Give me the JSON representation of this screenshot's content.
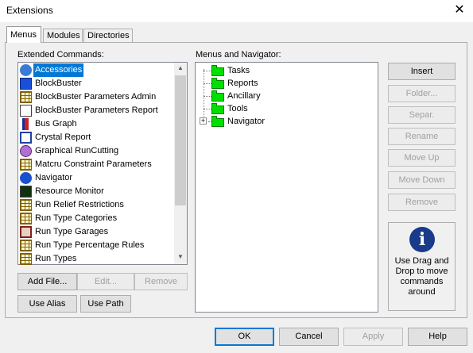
{
  "window": {
    "title": "Extensions",
    "close_glyph": "✕"
  },
  "tabs": [
    {
      "label": "Menus",
      "active": true
    },
    {
      "label": "Modules",
      "active": false
    },
    {
      "label": "Directories",
      "active": false
    }
  ],
  "extended": {
    "label": "Extended Commands:",
    "items": [
      {
        "label": "Accessories",
        "icon": "palette-icon",
        "selected": true
      },
      {
        "label": "BlockBuster",
        "icon": "book-icon"
      },
      {
        "label": "BlockBuster Parameters Admin",
        "icon": "table-icon"
      },
      {
        "label": "BlockBuster Parameters Report",
        "icon": "report-icon"
      },
      {
        "label": "Bus Graph",
        "icon": "bus-graph-icon"
      },
      {
        "label": "Crystal Report",
        "icon": "crystal-report-icon"
      },
      {
        "label": "Graphical RunCutting",
        "icon": "runcutting-icon"
      },
      {
        "label": "Matcru Constraint Parameters",
        "icon": "table-icon"
      },
      {
        "label": "Navigator",
        "icon": "navigator-icon"
      },
      {
        "label": "Resource Monitor",
        "icon": "monitor-icon"
      },
      {
        "label": "Run Relief Restrictions",
        "icon": "table-icon"
      },
      {
        "label": "Run Type Categories",
        "icon": "table-icon"
      },
      {
        "label": "Run Type Garages",
        "icon": "garage-icon"
      },
      {
        "label": "Run Type Percentage Rules",
        "icon": "table-icon"
      },
      {
        "label": "Run Types",
        "icon": "table-icon"
      }
    ],
    "buttons": {
      "add_file": "Add File...",
      "edit": "Edit...",
      "remove": "Remove",
      "use_alias": "Use Alias",
      "use_path": "Use Path"
    }
  },
  "menus": {
    "label": "Menus and Navigator:",
    "items": [
      {
        "label": "Tasks"
      },
      {
        "label": "Reports"
      },
      {
        "label": "Ancillary"
      },
      {
        "label": "Tools"
      },
      {
        "label": "Navigator",
        "expandable": true,
        "expander": "+"
      }
    ]
  },
  "side_buttons": {
    "insert": "Insert",
    "folder": "Folder...",
    "separ": "Separ.",
    "rename": "Rename",
    "move_up": "Move Up",
    "move_down": "Move Down",
    "remove": "Remove"
  },
  "info": {
    "icon_glyph": "i",
    "text": "Use Drag and Drop to move commands around"
  },
  "footer": {
    "ok": "OK",
    "cancel": "Cancel",
    "apply": "Apply",
    "help": "Help"
  },
  "colors": {
    "selection": "#0078d7",
    "folder": "#00e000",
    "info_icon": "#1a3a8a"
  }
}
